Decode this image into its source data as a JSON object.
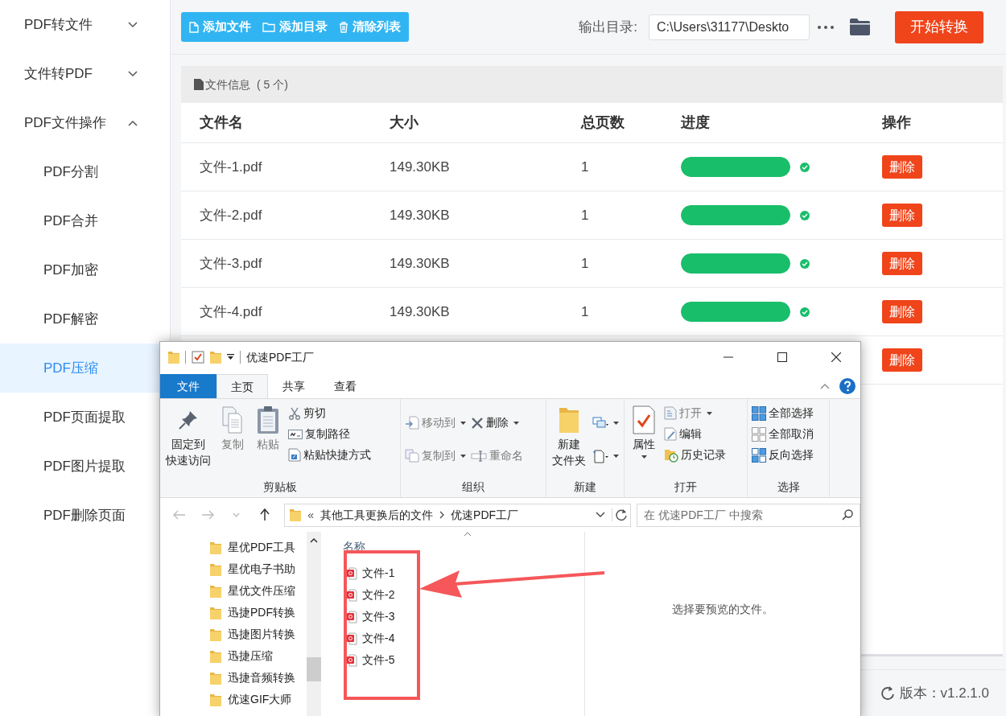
{
  "sidebar": {
    "items": [
      {
        "label": "PDF转文件",
        "expanded": false
      },
      {
        "label": "文件转PDF",
        "expanded": false
      },
      {
        "label": "PDF文件操作",
        "expanded": true,
        "children": [
          {
            "label": "PDF分割",
            "selected": false
          },
          {
            "label": "PDF合并",
            "selected": false
          },
          {
            "label": "PDF加密",
            "selected": false
          },
          {
            "label": "PDF解密",
            "selected": false
          },
          {
            "label": "PDF压缩",
            "selected": true
          },
          {
            "label": "PDF页面提取",
            "selected": false
          },
          {
            "label": "PDF图片提取",
            "selected": false
          },
          {
            "label": "PDF删除页面",
            "selected": false
          }
        ]
      }
    ]
  },
  "toolbar": {
    "buttons": [
      "添加文件",
      "添加目录",
      "清除列表"
    ],
    "output_label": "输出目录:",
    "output_path": "C:\\Users\\31177\\Deskto",
    "start_button": "开始转换"
  },
  "file_panel": {
    "title": "文件信息",
    "count": "( 5 个)",
    "columns": [
      "文件名",
      "大小",
      "总页数",
      "进度",
      "操作"
    ],
    "rows": [
      {
        "name": "文件-1.pdf",
        "size": "149.30KB",
        "pages": "1",
        "level": 1,
        "done": true,
        "action": "删除"
      },
      {
        "name": "文件-2.pdf",
        "size": "149.30KB",
        "pages": "1",
        "level": 1,
        "done": true,
        "action": "删除"
      },
      {
        "name": "文件-3.pdf",
        "size": "149.30KB",
        "pages": "1",
        "level": 1,
        "done": true,
        "action": "删除"
      },
      {
        "name": "文件-4.pdf",
        "size": "149.30KB",
        "pages": "1",
        "level": 1,
        "done": true,
        "action": "删除"
      },
      {
        "action": "删除"
      }
    ]
  },
  "version": "版本：v1.2.1.0",
  "explorer": {
    "title": "优速PDF工厂",
    "file_menu": "文件",
    "tabs": [
      {
        "label": "主页",
        "selected": true
      },
      {
        "label": "共享",
        "selected": false
      },
      {
        "label": "查看",
        "selected": false
      }
    ],
    "ribbon": [
      {
        "group": "剪贴板",
        "items": [
          {
            "kind": "large",
            "lines": [
              "固定到",
              "快速访问"
            ],
            "disabled": false
          },
          {
            "kind": "large",
            "lines": [
              "复制"
            ],
            "disabled": true
          },
          {
            "kind": "large",
            "lines": [
              "粘贴"
            ],
            "disabled": true
          },
          {
            "kind": "stack",
            "items": [
              {
                "label": "剪切",
                "disabled": false
              },
              {
                "label": "复制路径",
                "disabled": false
              },
              {
                "label": "粘贴快捷方式",
                "disabled": false
              }
            ]
          }
        ]
      },
      {
        "group": "组织",
        "items": [
          {
            "kind": "stack",
            "items": [
              {
                "label": "移动到",
                "disabled": true,
                "dropdown": true
              },
              {
                "label": "复制到",
                "disabled": true,
                "dropdown": true
              }
            ]
          },
          {
            "kind": "stack",
            "items": [
              {
                "label": "删除",
                "disabled": false,
                "dropdown": true
              },
              {
                "label": "重命名",
                "disabled": true
              }
            ]
          }
        ]
      },
      {
        "group": "新建",
        "items": [
          {
            "kind": "large",
            "lines": [
              "新建",
              "文件夹"
            ],
            "disabled": false
          },
          {
            "kind": "stack",
            "items": [
              {
                "dropdown": true
              },
              {
                "dropdown": true
              }
            ]
          }
        ]
      },
      {
        "group": "打开",
        "items": [
          {
            "kind": "large",
            "lines": [
              "属性"
            ],
            "disabled": false,
            "dropdown": true
          },
          {
            "kind": "stack",
            "items": [
              {
                "label": "打开",
                "disabled": true,
                "dropdown": true
              },
              {
                "label": "编辑",
                "disabled": false
              },
              {
                "label": "历史记录",
                "disabled": false
              }
            ]
          }
        ]
      },
      {
        "group": "选择",
        "items": [
          {
            "kind": "stack",
            "items": [
              {
                "label": "全部选择",
                "disabled": false
              },
              {
                "label": "全部取消",
                "disabled": false
              },
              {
                "label": "反向选择",
                "disabled": false
              }
            ]
          }
        ]
      }
    ],
    "address": {
      "prefix": "«",
      "segments": [
        "其他工具更换后的文件",
        "优速PDF工厂"
      ]
    },
    "search": {
      "placeholder": "在 优速PDF工厂 中搜索"
    },
    "nav": [
      "星优PDF工具",
      "星优电子书助",
      "星优文件压缩",
      "迅捷PDF转换",
      "迅捷图片转换",
      "迅捷压缩",
      "迅捷音频转换",
      "优速GIF大师"
    ],
    "list_header": "名称",
    "files": [
      "文件-1",
      "文件-2",
      "文件-3",
      "文件-4",
      "文件-5"
    ],
    "preview_text": "选择要预览的文件。"
  }
}
